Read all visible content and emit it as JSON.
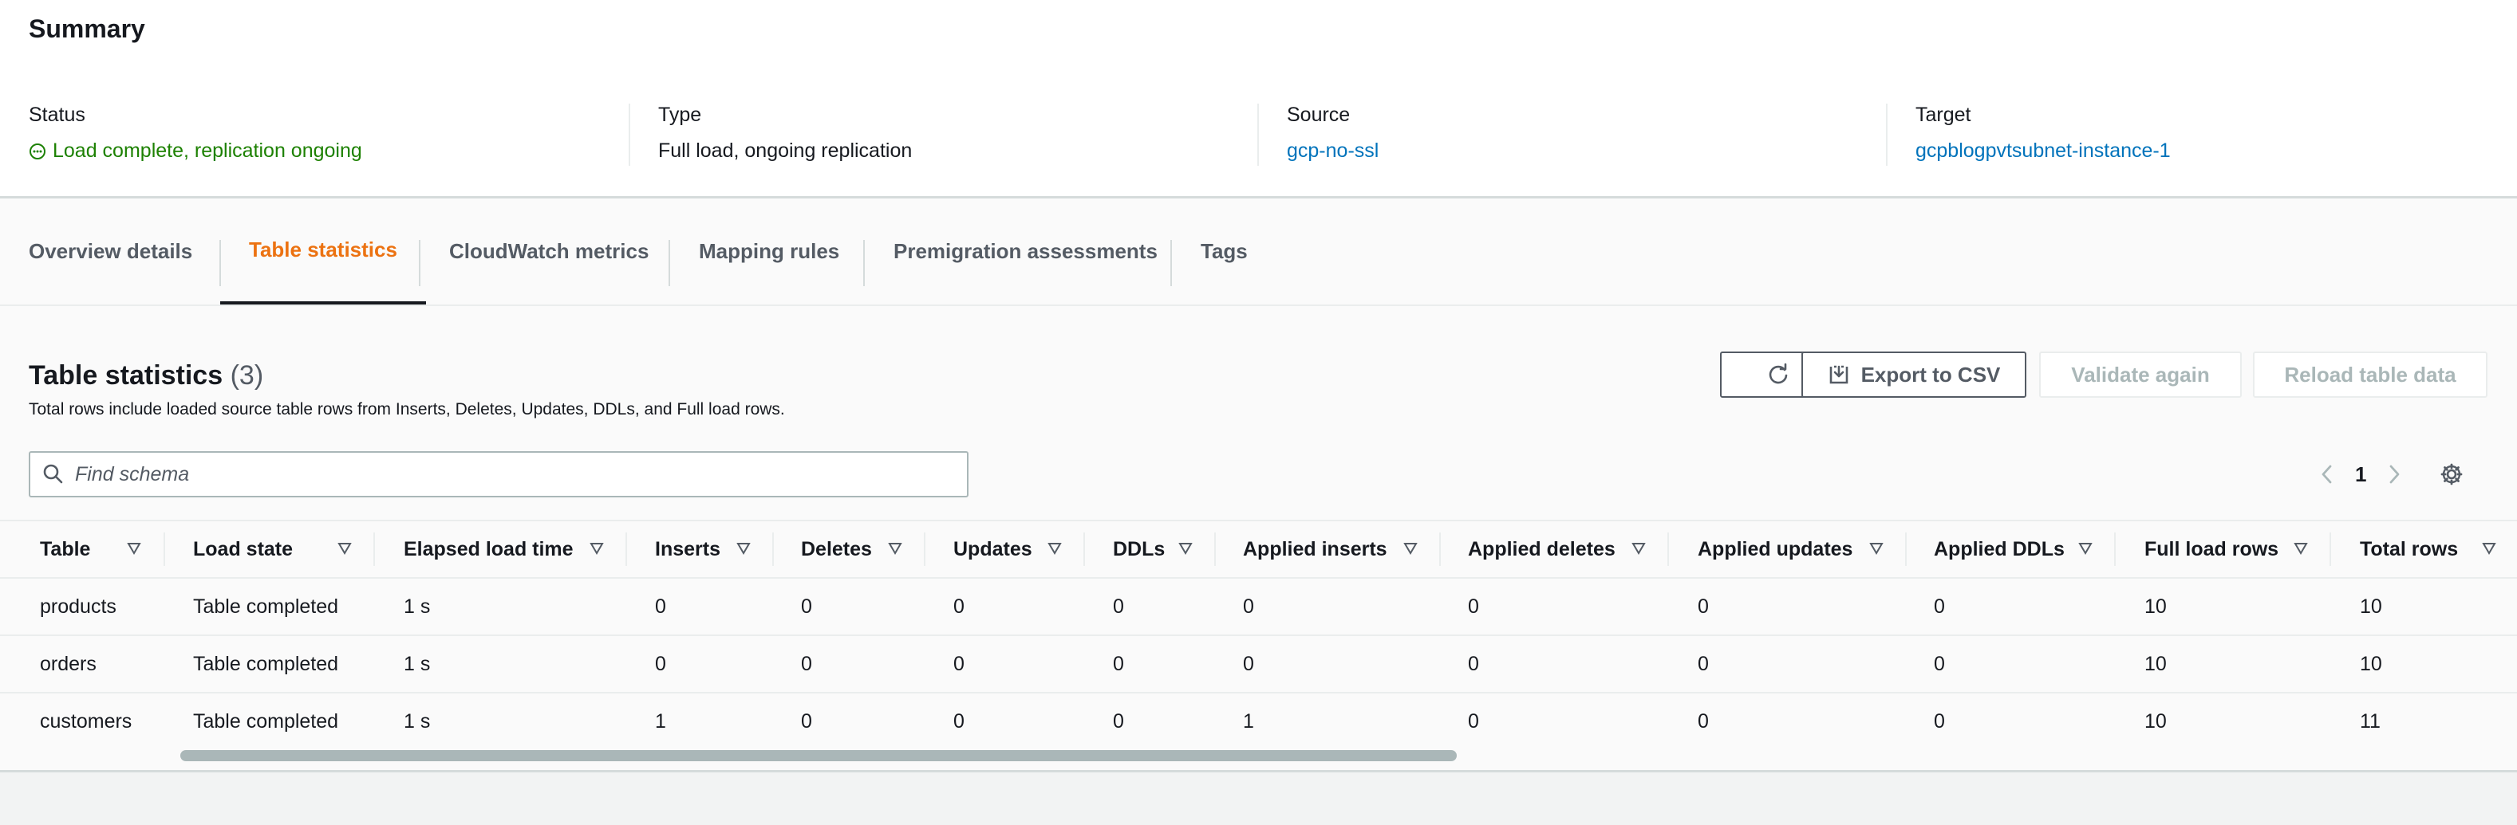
{
  "summary": {
    "title": "Summary",
    "status": {
      "label": "Status",
      "value": "Load complete, replication ongoing",
      "color": "#1d8102"
    },
    "type": {
      "label": "Type",
      "value": "Full load, ongoing replication"
    },
    "source": {
      "label": "Source",
      "value": "gcp-no-ssl"
    },
    "target": {
      "label": "Target",
      "value": "gcpblogpvtsubnet-instance-1"
    }
  },
  "tabs": [
    {
      "label": "Overview details",
      "active": false
    },
    {
      "label": "Table statistics",
      "active": true
    },
    {
      "label": "CloudWatch metrics",
      "active": false
    },
    {
      "label": "Mapping rules",
      "active": false
    },
    {
      "label": "Premigration assessments",
      "active": false
    },
    {
      "label": "Tags",
      "active": false
    }
  ],
  "panel": {
    "title": "Table statistics",
    "count": "(3)",
    "description": "Total rows include loaded source table rows from Inserts, Deletes, Updates, DDLs, and Full load rows.",
    "buttons": {
      "refresh_icon": "refresh-icon",
      "export": "Export to CSV",
      "validate": "Validate again",
      "reload": "Reload table data"
    },
    "search_placeholder": "Find schema",
    "page": "1"
  },
  "table": {
    "columns": [
      "Table",
      "Load state",
      "Elapsed load time",
      "Inserts",
      "Deletes",
      "Updates",
      "DDLs",
      "Applied inserts",
      "Applied deletes",
      "Applied updates",
      "Applied DDLs",
      "Full load rows",
      "Total rows"
    ],
    "rows": [
      [
        "products",
        "Table completed",
        "1 s",
        "0",
        "0",
        "0",
        "0",
        "0",
        "0",
        "0",
        "0",
        "10",
        "10"
      ],
      [
        "orders",
        "Table completed",
        "1 s",
        "0",
        "0",
        "0",
        "0",
        "0",
        "0",
        "0",
        "0",
        "10",
        "10"
      ],
      [
        "customers",
        "Table completed",
        "1 s",
        "1",
        "0",
        "0",
        "0",
        "1",
        "0",
        "0",
        "0",
        "10",
        "11"
      ]
    ]
  },
  "colors": {
    "accent": "#ec7211",
    "link": "#0073bb",
    "success": "#1d8102"
  }
}
